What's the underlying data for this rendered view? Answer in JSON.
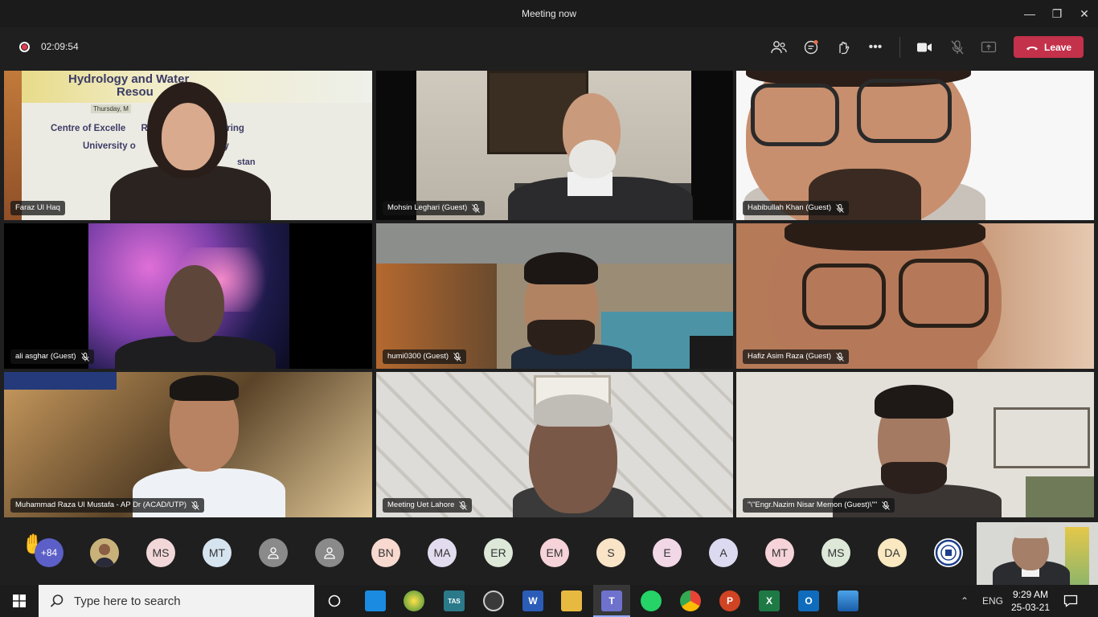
{
  "window": {
    "title": "Meeting now"
  },
  "toolbar": {
    "timer": "02:09:54",
    "leave_label": "Leave"
  },
  "tiles": [
    {
      "name": "Faraz Ul Haq",
      "muted": false,
      "banner_lines": [
        "Hydrology and Water",
        "Resou",
        "Thursday, M",
        "Centre of Excelle      Resources Engineering",
        "University o         and Technology",
        "stan"
      ]
    },
    {
      "name": "Mohsin Leghari (Guest)",
      "muted": true
    },
    {
      "name": "Habibullah Khan (Guest)",
      "muted": true
    },
    {
      "name": "ali asghar (Guest)",
      "muted": true
    },
    {
      "name": "humi0300 (Guest)",
      "muted": true
    },
    {
      "name": "Hafiz Asim Raza (Guest)",
      "muted": true
    },
    {
      "name": "Muhammad Raza Ul Mustafa - AP Dr (ACAD/UTP)",
      "muted": true
    },
    {
      "name": "Meeting Uet Lahore",
      "muted": true
    },
    {
      "name": "\"\\\"Engr.Nazim Nisar Memon (Guest)\\\"\"",
      "muted": true
    }
  ],
  "roster": {
    "overflow_count": "+84",
    "avatars": [
      {
        "initials": "MS",
        "color": "#f2d7d9"
      },
      {
        "initials": "MT",
        "color": "#d6e4f0"
      },
      {
        "initials": "",
        "color": "#8a8a8a"
      },
      {
        "initials": "",
        "color": "#8a8a8a"
      },
      {
        "initials": "BN",
        "color": "#f8d9cf"
      },
      {
        "initials": "MA",
        "color": "#e3dcef"
      },
      {
        "initials": "ER",
        "color": "#dde8d8"
      },
      {
        "initials": "EM",
        "color": "#f5d3d8"
      },
      {
        "initials": "S",
        "color": "#f9e4c8"
      },
      {
        "initials": "E",
        "color": "#f2d7e6"
      },
      {
        "initials": "A",
        "color": "#dcdaf0"
      },
      {
        "initials": "MT",
        "color": "#f5d3d8"
      },
      {
        "initials": "MS",
        "color": "#dde8d8"
      },
      {
        "initials": "DA",
        "color": "#f9e8c0"
      }
    ]
  },
  "taskbar": {
    "search_placeholder": "Type here to search",
    "language": "ENG",
    "time": "9:29 AM",
    "date": "25-03-21"
  },
  "colors": {
    "leave": "#c4314b",
    "record": "#e33b50",
    "teams": "#5b5fc7"
  }
}
